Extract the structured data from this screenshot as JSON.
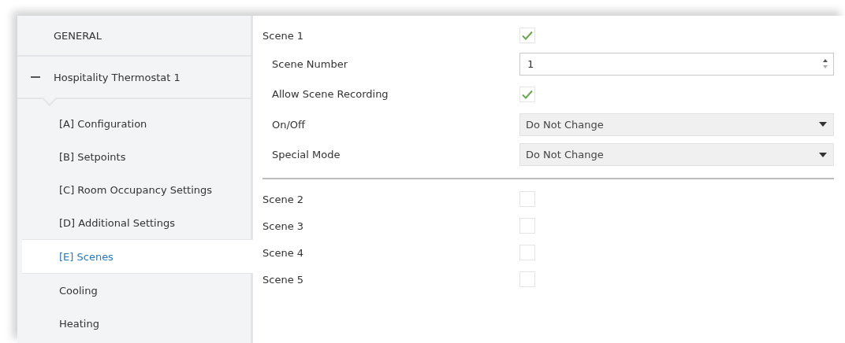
{
  "sidebar": {
    "items": [
      {
        "label": "GENERAL",
        "kind": "section",
        "selected": false
      },
      {
        "label": "Hospitality Thermostat 1",
        "kind": "group",
        "expanded": true,
        "selected": false,
        "children": [
          {
            "label": "[A] Configuration",
            "selected": false
          },
          {
            "label": "[B] Setpoints",
            "selected": false
          },
          {
            "label": "[C] Room Occupancy Settings",
            "selected": false
          },
          {
            "label": "[D] Additional Settings",
            "selected": false
          },
          {
            "label": "[E] Scenes",
            "selected": true
          },
          {
            "label": "Cooling",
            "selected": false
          },
          {
            "label": "Heating",
            "selected": false
          }
        ]
      }
    ]
  },
  "scenes": [
    {
      "label": "Scene 1",
      "checked": true,
      "settings": [
        {
          "kind": "number",
          "label": "Scene Number",
          "value": "1"
        },
        {
          "kind": "checkbox",
          "label": "Allow Scene Recording",
          "checked": true
        },
        {
          "kind": "dropdown",
          "label": "On/Off",
          "value": "Do Not Change"
        },
        {
          "kind": "dropdown",
          "label": "Special Mode",
          "value": "Do Not Change"
        }
      ]
    },
    {
      "label": "Scene 2",
      "checked": false
    },
    {
      "label": "Scene 3",
      "checked": false
    },
    {
      "label": "Scene 4",
      "checked": false
    },
    {
      "label": "Scene 5",
      "checked": false
    }
  ]
}
